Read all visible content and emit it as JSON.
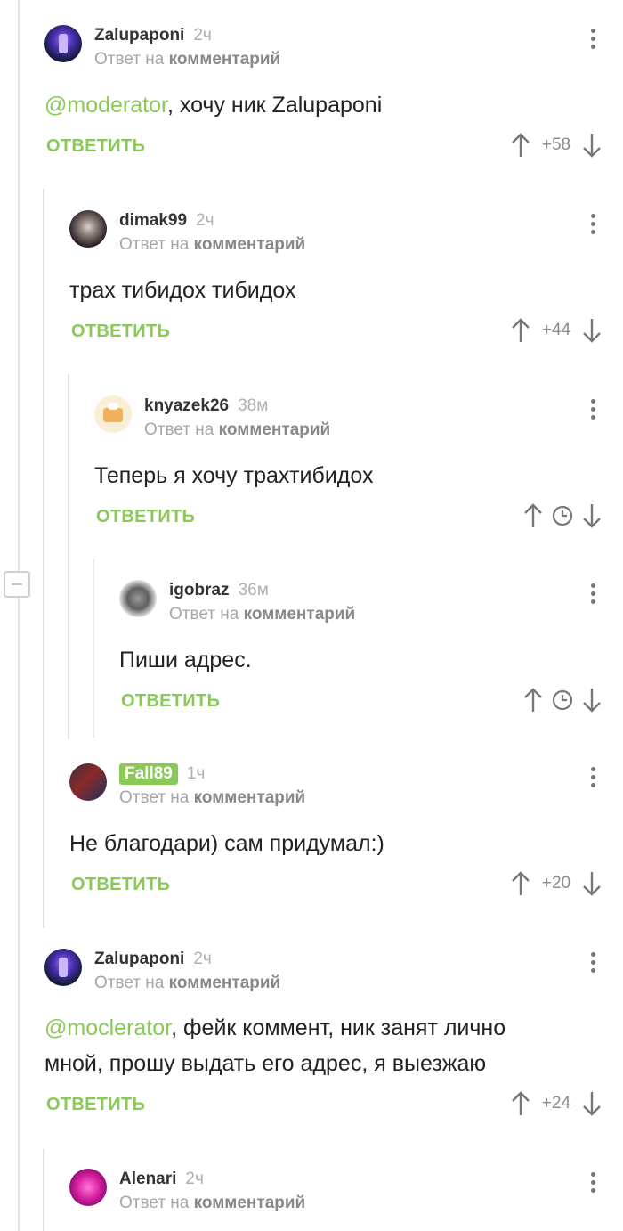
{
  "reply_hint_prefix": "Ответ на",
  "reply_hint_target": "комментарий",
  "reply_label": "ОТВЕТИТЬ",
  "comments": [
    {
      "author": "Zalupaponi",
      "time": "2ч",
      "mention": "@moderator",
      "text": ", хочу ник Zalupaponi",
      "score": "+58"
    },
    {
      "author": "dimak99",
      "time": "2ч",
      "text": "трах тибидох тибидох",
      "score": "+44"
    },
    {
      "author": "knyazek26",
      "time": "38м",
      "text": "Теперь я хочу трахтибидох"
    },
    {
      "author": "igobraz",
      "time": "36м",
      "text": "Пиши адрес."
    },
    {
      "author": "Fall89",
      "time": "1ч",
      "text": "Не благодари) сам придумал:)",
      "score": "+20"
    },
    {
      "author": "Zalupaponi",
      "time": "2ч",
      "mention": "@moclerator",
      "text_line1": ", фейк коммент, ник занят лично",
      "text_line2": "мной, прошу выдать его адрес, я выезжаю",
      "score": "+24"
    },
    {
      "author": "Alenari",
      "time": "2ч"
    }
  ],
  "icons": {
    "upvote": "arrow-up-icon",
    "downvote": "arrow-down-icon",
    "pending": "clock-icon",
    "menu": "more-vertical-icon",
    "collapse": "collapse-icon"
  },
  "colors": {
    "accent": "#8ac858",
    "muted": "#a6a6a6",
    "thread_line": "#e2e2e2"
  }
}
